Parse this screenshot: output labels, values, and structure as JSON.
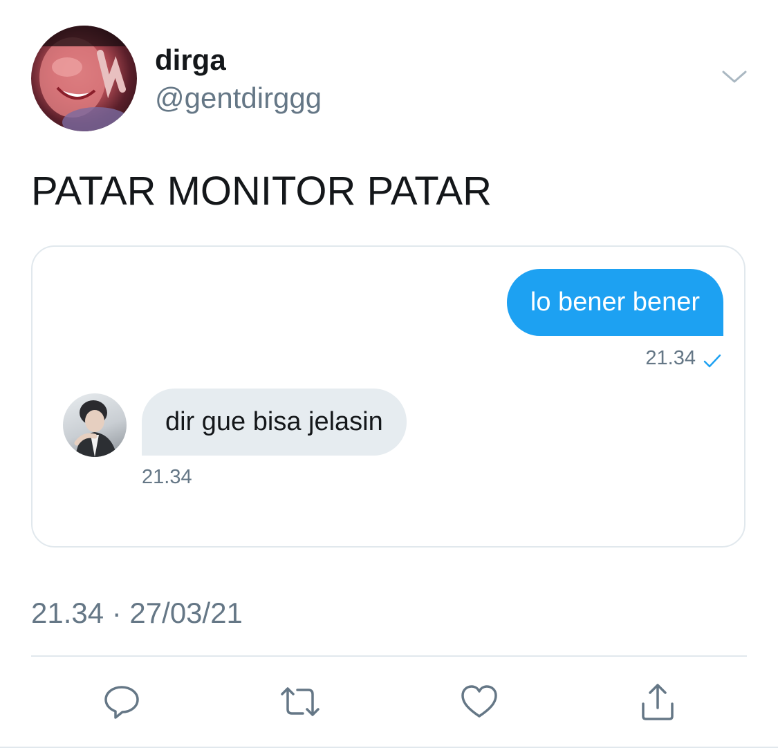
{
  "tweet": {
    "author": {
      "display_name": "dirga",
      "handle": "@gentdirggg"
    },
    "text": "PATAR MONITOR PATAR",
    "timestamp": "21.34 · 27/03/21",
    "menu_icon": "chevron-down-icon"
  },
  "dm_screenshot": {
    "outgoing": {
      "text": "lo bener bener",
      "time": "21.34",
      "status_icon": "check-icon"
    },
    "incoming": {
      "text": "dir gue bisa jelasin",
      "time": "21.34"
    }
  },
  "actions": {
    "icons": [
      "reply-icon",
      "retweet-icon",
      "like-icon",
      "share-icon"
    ]
  },
  "colors": {
    "accent": "#1da1f2",
    "secondary_text": "#657786",
    "primary_text": "#14171a",
    "incoming_bubble": "#e6ecf0",
    "border": "#e1e8ed"
  }
}
